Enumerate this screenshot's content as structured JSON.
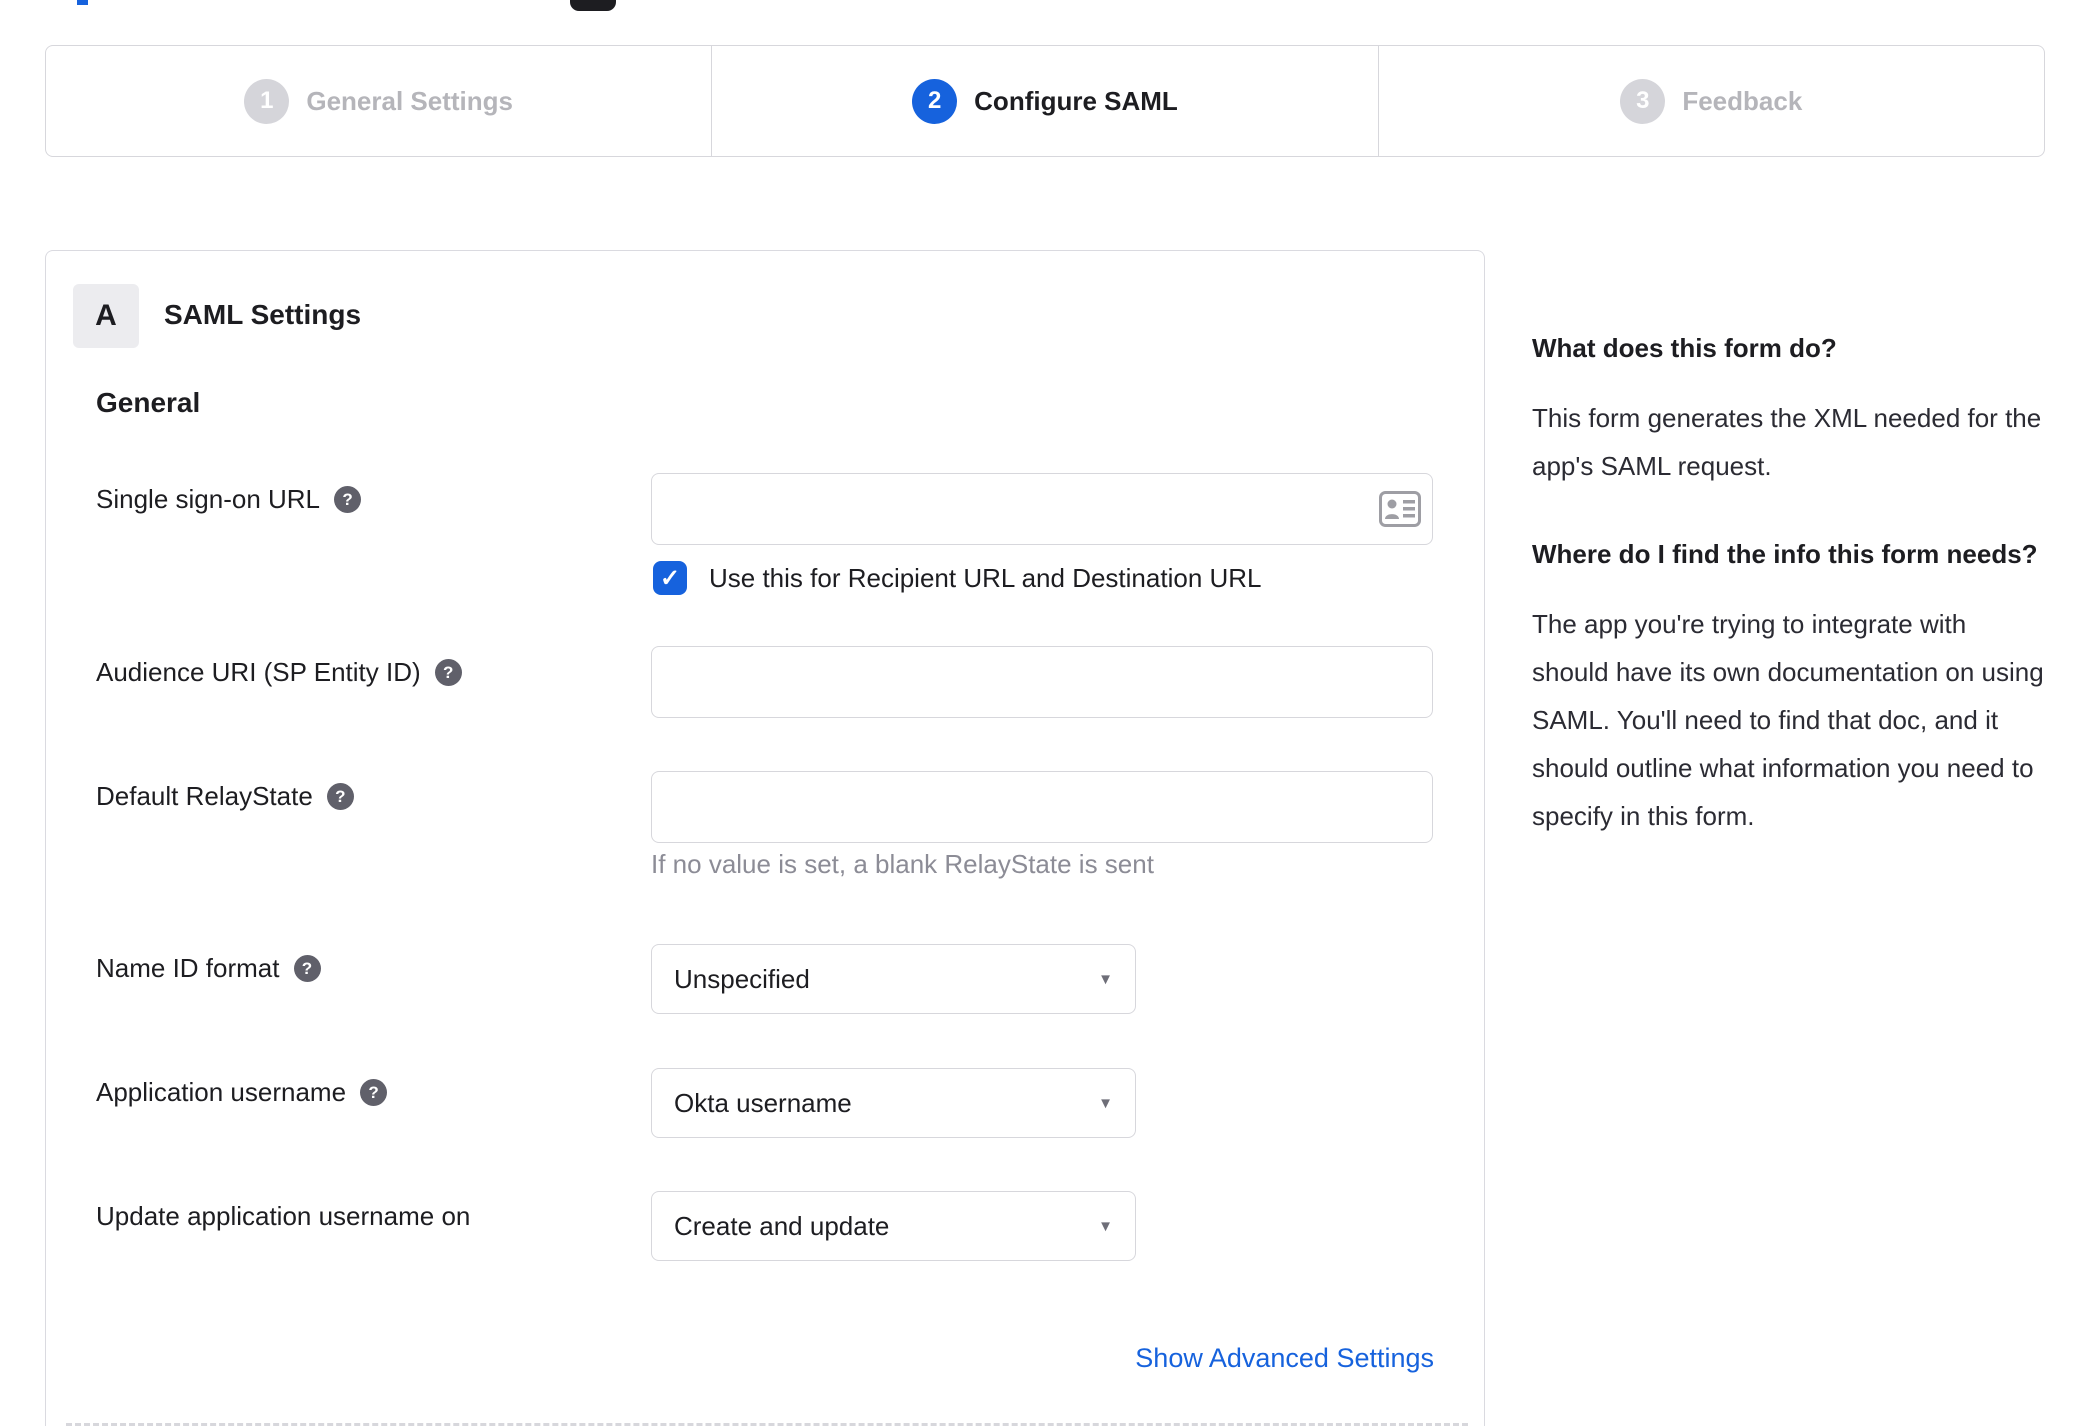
{
  "colors": {
    "accent_blue": "#1662dd",
    "inactive_gray": "#d5d5da",
    "border_gray": "#d7d7dc",
    "help_circle_gray": "#60606a",
    "hint_gray": "#8c8c96"
  },
  "icons": {
    "help": "?",
    "checkbox_check": "✓",
    "dropdown_arrow": "▼",
    "input_right": "contact-card"
  },
  "stepper": {
    "step1": {
      "number": "1",
      "label": "General Settings",
      "state": "inactive"
    },
    "step2": {
      "number": "2",
      "label": "Configure SAML",
      "state": "active"
    },
    "step3": {
      "number": "3",
      "label": "Feedback",
      "state": "inactive"
    }
  },
  "saml": {
    "badge": "A",
    "title": "SAML Settings",
    "section": "General",
    "sso": {
      "label": "Single sign-on URL",
      "value": "",
      "checkbox_label": "Use this for Recipient URL and Destination URL",
      "checked": true
    },
    "audience": {
      "label": "Audience URI (SP Entity ID)",
      "value": ""
    },
    "relay": {
      "label": "Default RelayState",
      "value": "",
      "hint": "If no value is set, a blank RelayState is sent"
    },
    "nameid": {
      "label": "Name ID format",
      "value": "Unspecified"
    },
    "appuser": {
      "label": "Application username",
      "value": "Okta username"
    },
    "updateuser": {
      "label": "Update application username on",
      "value": "Create and update"
    },
    "advanced_link": "Show Advanced Settings"
  },
  "help_panel": {
    "q1": "What does this form do?",
    "a1": "This form generates the XML needed for the app's SAML request.",
    "q2": "Where do I find the info this form needs?",
    "a2": "The app you're trying to integrate with should have its own documentation on using SAML. You'll need to find that doc, and it should outline what information you need to specify in this form."
  }
}
